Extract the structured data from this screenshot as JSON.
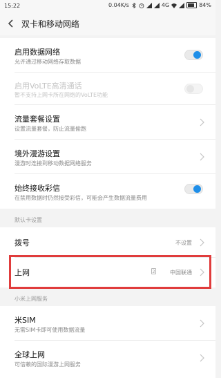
{
  "status_bar": {
    "time": "15:22",
    "net_speed": "0.04K/s",
    "network_type": "4G",
    "battery": "84%",
    "icons": [
      "bluetooth-icon",
      "alarm-icon",
      "signal-icon",
      "signal-icon",
      "wifi-icon",
      "signal-icon",
      "battery-icon"
    ]
  },
  "header": {
    "title": "双卡和移动网络",
    "back_icon": "chevron-left-icon"
  },
  "settings": {
    "mobile_data": {
      "label": "启用数据网络",
      "desc": "允许通过移动网络存取数据",
      "enabled": true
    },
    "volte": {
      "label": "启用VoLTE高清通话",
      "desc": "暂不支持上网卡所在网络的VoLTE功能",
      "enabled": false
    },
    "data_plan": {
      "label": "流量套餐设置",
      "desc": "设置流量套餐，防止流量偷跑"
    },
    "roaming": {
      "label": "境外漫游设置",
      "desc": "漫游时连接到移动数据网络服务"
    },
    "mms": {
      "label": "始终接收彩信",
      "desc": "在禁用数据时仍然接受彩信，可能会产生数据流量费用",
      "enabled": true
    }
  },
  "default_card_section": {
    "title": "默认卡设置"
  },
  "dial": {
    "label": "拨号",
    "value": "不设置"
  },
  "internet": {
    "label": "上网",
    "sim_badge": "2",
    "value": "中国联通"
  },
  "mi_service_section": {
    "title": "小米上网服务"
  },
  "mi_sim": {
    "label": "米SIM",
    "desc": "无需SIM卡即可使用数据流量"
  },
  "global_internet": {
    "label": "全球上网",
    "desc": "可信赖的国际漫游上网服务"
  },
  "colors": {
    "accent": "#1e8ee8",
    "highlight": "#e03c3c",
    "background": "#f3f3f3"
  }
}
